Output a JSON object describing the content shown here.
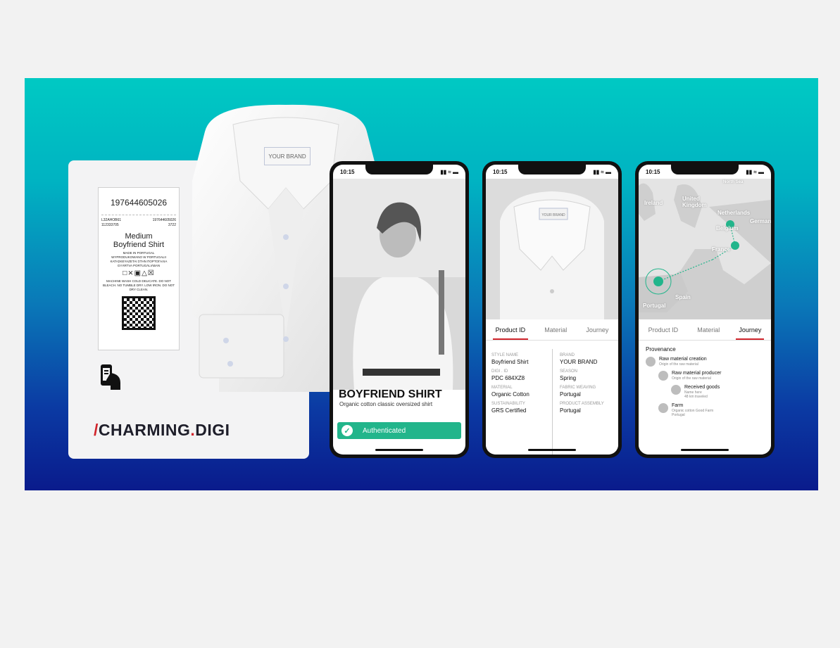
{
  "tag": {
    "barcode": "197644605026",
    "row1_left": "L32AHOB61",
    "row1_right": "197644605026",
    "row2_left": "112333705",
    "row2_right": "3722",
    "size": "Medium",
    "name": "Boyfriend Shirt",
    "made_in": "MADE IN PORTUGAL\nWYPRODUKOWANO W PORTUGALII\nΚΑΤΑΣΚΕΥΑΖΕΤΑΙ ΣΤΗΝ ΠΟΡΤΟΓΑΛΙΑ\nGYÁRTVA PORTUGÁLIÁBAN",
    "care_text": "MACHINE WASH COLD DELICATE. DO NOT BLEACH. NO TUMBLE DRY. LOW IRON. DO NOT DRY CLEAN."
  },
  "logo": {
    "slash": "/",
    "part1": "CHARMING",
    "dot": ".",
    "part2": "DIGI"
  },
  "shirt_label": "YOUR BRAND",
  "time": "10:15",
  "phone1": {
    "title": "BOYFRIEND SHIRT",
    "subtitle": "Organic cotton classic oversized shirt",
    "auth": "Authenticated"
  },
  "tabs": [
    "Product ID",
    "Material",
    "Journey"
  ],
  "phone2": {
    "photo_label": "YOUR BRAND",
    "left": [
      {
        "k": "STYLE NAME",
        "v": "Boyfriend Shirt"
      },
      {
        "k": "DIGI . ID",
        "v": "PDC 684XZ8"
      },
      {
        "k": "MATERIAL",
        "v": "Organic Cotton"
      },
      {
        "k": "SUSTAINABILITY",
        "v": "GRS Certified"
      }
    ],
    "right": [
      {
        "k": "BRAND",
        "v": "YOUR BRAND"
      },
      {
        "k": "SEASON",
        "v": "Spring"
      },
      {
        "k": "FABRIC WEAVING",
        "v": "Portugal"
      },
      {
        "k": "PRODUCT ASSEMBLY",
        "v": "Portugal"
      }
    ]
  },
  "phone3": {
    "map_labels": [
      "North Sea",
      "Ireland",
      "United Kingdom",
      "Netherlands",
      "Belgium",
      "German",
      "France",
      "Spain",
      "Portugal"
    ],
    "heading": "Provenance",
    "steps": [
      {
        "t": "Raw material creation",
        "d": "Origin of the raw material"
      },
      {
        "t": "Raw material producer",
        "d": "Origin of the raw material"
      },
      {
        "t": "Received goods",
        "d": "Name here\n48 km traveled"
      },
      {
        "t": "Farm",
        "d": "Organic cotton Good Farm\nPortugal"
      }
    ]
  }
}
